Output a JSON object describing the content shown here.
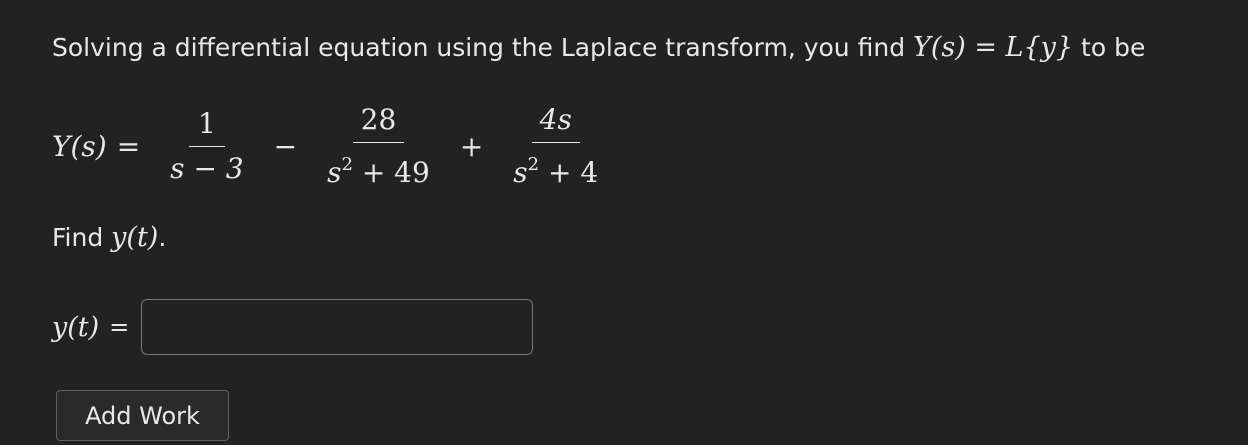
{
  "prompt": {
    "text_before": "Solving a differential equation using the Laplace transform, you find ",
    "math": "Y(s) = L{y}",
    "text_after": " to be"
  },
  "equation": {
    "lhs": "Y(s)",
    "equals": "=",
    "term1_num": "1",
    "term1_den": "s − 3",
    "op1": "−",
    "term2_num": "28",
    "term2_den_base": "s",
    "term2_den_exp": "2",
    "term2_den_rest": " + 49",
    "op2": "+",
    "term3_num": "4s",
    "term3_den_base": "s",
    "term3_den_exp": "2",
    "term3_den_rest": " + 4"
  },
  "find": {
    "text": "Find ",
    "math": "y(t)",
    "period": "."
  },
  "answer": {
    "label": "y(t)",
    "equals": "=",
    "value": "",
    "placeholder": ""
  },
  "add_work": {
    "label": "Add Work"
  }
}
